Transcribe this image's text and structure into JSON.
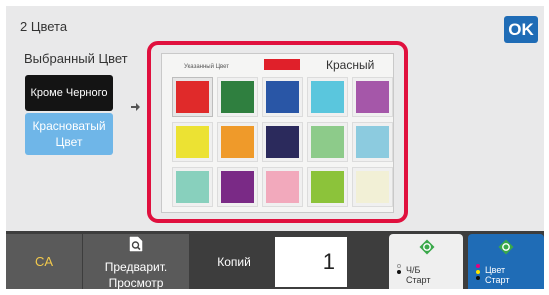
{
  "screen_title": "2 Цвета",
  "ok_label": "OK",
  "selected_color_label": "Выбранный Цвет",
  "mode_buttons": {
    "except_black": "Кроме Черного",
    "reddish": "Красноватый Цвет"
  },
  "palette": {
    "specified_label": "Указанный Цвет",
    "specified_color_name": "Красный",
    "specified_color_hex": "#e0202a",
    "swatches": [
      {
        "id": "red",
        "color": "#e02a2a",
        "selected": true
      },
      {
        "id": "green",
        "color": "#2f7f3f",
        "selected": false
      },
      {
        "id": "blue",
        "color": "#2956a6",
        "selected": false
      },
      {
        "id": "cyan",
        "color": "#5ac6dd",
        "selected": false
      },
      {
        "id": "purple",
        "color": "#a557a9",
        "selected": false
      },
      {
        "id": "yellow",
        "color": "#ece233",
        "selected": false
      },
      {
        "id": "orange",
        "color": "#ef9a2a",
        "selected": false
      },
      {
        "id": "navy",
        "color": "#2b2a5c",
        "selected": false
      },
      {
        "id": "light-green",
        "color": "#8dcb8a",
        "selected": false
      },
      {
        "id": "light-blue",
        "color": "#8ccbdf",
        "selected": false
      },
      {
        "id": "mint",
        "color": "#88d0bd",
        "selected": false
      },
      {
        "id": "violet",
        "color": "#7a2a86",
        "selected": false
      },
      {
        "id": "pink",
        "color": "#f2a9bc",
        "selected": false
      },
      {
        "id": "lime",
        "color": "#8cc33a",
        "selected": false
      },
      {
        "id": "cream",
        "color": "#f2f0d6",
        "selected": false
      }
    ]
  },
  "bottom_bar": {
    "ca_label": "CA",
    "preview_line1": "Предварит.",
    "preview_line2": "Просмотр",
    "copies_label": "Копий",
    "copies_value": "1",
    "bw_line1": "Ч/Б",
    "bw_line2": "Старт",
    "color_line1": "Цвет",
    "color_line2": "Старт"
  },
  "colors": {
    "accent_blue": "#1f6cb6",
    "highlight_red": "#e0103e",
    "start_green": "#3aa84a"
  }
}
